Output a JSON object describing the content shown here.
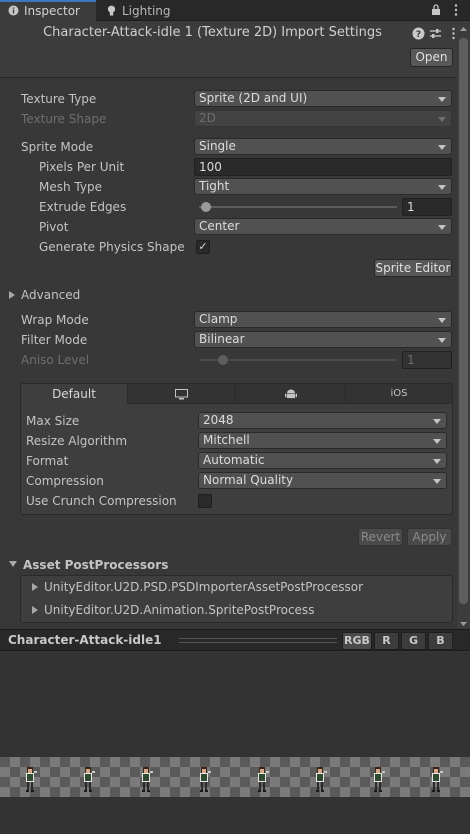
{
  "tabs": {
    "inspector": "Inspector",
    "lighting": "Lighting"
  },
  "header": {
    "title": "Character-Attack-idle 1 (Texture 2D) Import Settings",
    "open_button": "Open"
  },
  "texture": {
    "texture_type_label": "Texture Type",
    "texture_type_value": "Sprite (2D and UI)",
    "texture_shape_label": "Texture Shape",
    "texture_shape_value": "2D",
    "sprite_mode_label": "Sprite Mode",
    "sprite_mode_value": "Single",
    "ppu_label": "Pixels Per Unit",
    "ppu_value": "100",
    "mesh_type_label": "Mesh Type",
    "mesh_type_value": "Tight",
    "extrude_label": "Extrude Edges",
    "extrude_value": "1",
    "pivot_label": "Pivot",
    "pivot_value": "Center",
    "physics_label": "Generate Physics Shape",
    "sprite_editor_button": "Sprite Editor",
    "advanced_label": "Advanced",
    "wrap_label": "Wrap Mode",
    "wrap_value": "Clamp",
    "filter_label": "Filter Mode",
    "filter_value": "Bilinear",
    "aniso_label": "Aniso Level",
    "aniso_value": "1"
  },
  "platform": {
    "default_tab": "Default",
    "ios_tab": "iOS",
    "max_size_label": "Max Size",
    "max_size_value": "2048",
    "resize_label": "Resize Algorithm",
    "resize_value": "Mitchell",
    "format_label": "Format",
    "format_value": "Automatic",
    "compression_label": "Compression",
    "compression_value": "Normal Quality",
    "crunch_label": "Use Crunch Compression"
  },
  "actions": {
    "revert": "Revert",
    "apply": "Apply"
  },
  "postprocessors": {
    "title": "Asset PostProcessors",
    "items": [
      "UnityEditor.U2D.PSD.PSDImporterAssetPostProcessor",
      "UnityEditor.U2D.Animation.SpritePostProcess"
    ]
  },
  "preview": {
    "name": "Character-Attack-idle1",
    "channels": [
      "RGB",
      "R",
      "G",
      "B"
    ]
  },
  "colors": {
    "background": "#383838",
    "tab_accent": "#3a79bb"
  }
}
